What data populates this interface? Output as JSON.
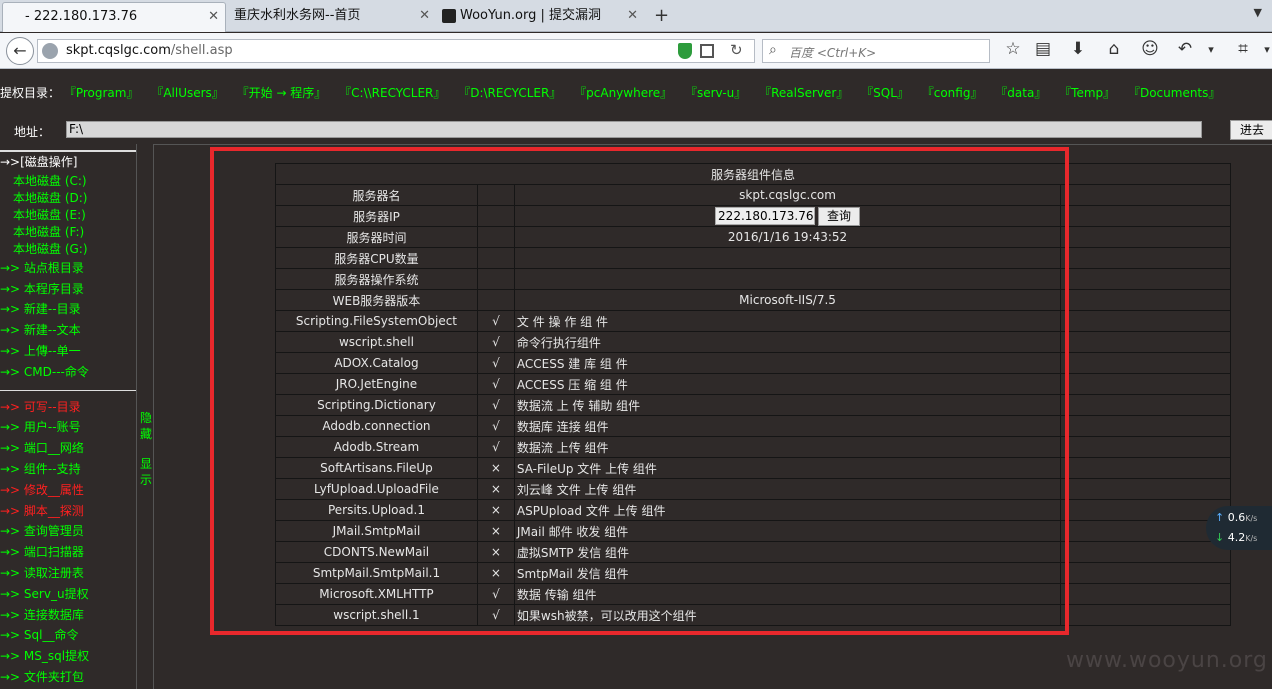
{
  "browser": {
    "tabs": [
      {
        "title": "- 222.180.173.76",
        "active": true
      },
      {
        "title": "重庆水利水务网--首页",
        "active": false
      },
      {
        "title": "WooYun.org | 提交漏洞",
        "active": false
      }
    ],
    "new_tab": "+",
    "url_domain": "skpt.cqslgc.com",
    "url_path": "/shell.asp",
    "url_prefix": "",
    "search_placeholder": "百度 <Ctrl+K>"
  },
  "page": {
    "priv_label": "提权目录：",
    "priv_links": [
      "『Program』",
      "『AllUsers』",
      "『开始 → 程序』",
      "『C:\\\\RECYCLER』",
      "『D:\\RECYCLER』",
      "『pcAnywhere』",
      "『serv-u』",
      "『RealServer』",
      "『SQL』",
      "『config』",
      "『data』",
      "『Temp』",
      "『Documents』"
    ],
    "address_label": "地址：",
    "address_value": "F:\\",
    "go_button": "进去",
    "sidebar": {
      "disk_header": "→>[磁盘操作]",
      "drives": [
        "本地磁盘 (C:)",
        "本地磁盘 (D:)",
        "本地磁盘 (E:)",
        "本地磁盘 (F:)",
        "本地磁盘 (G:)"
      ],
      "group1": [
        {
          "label": "→> 站点根目录",
          "red": false
        },
        {
          "label": "→> 本程序目录",
          "red": false
        },
        {
          "label": "→> 新建--目录",
          "red": false
        },
        {
          "label": "→> 新建--文本",
          "red": false
        },
        {
          "label": "→> 上傳--单一",
          "red": false
        },
        {
          "label": "→> CMD---命令",
          "red": false
        }
      ],
      "group2": [
        {
          "label": "→> 可写--目录",
          "red": true
        },
        {
          "label": "→> 用户--账号",
          "red": false
        },
        {
          "label": "→> 端口__网络",
          "red": false
        },
        {
          "label": "→> 组件--支持",
          "red": false
        },
        {
          "label": "→> 修改__属性",
          "red": true
        },
        {
          "label": "→> 脚本__探测",
          "red": true
        },
        {
          "label": "→> 查询管理员",
          "red": false
        },
        {
          "label": "→> 端口扫描器",
          "red": false
        },
        {
          "label": "→> 读取注册表",
          "red": false
        },
        {
          "label": "→> Serv_u提权",
          "red": false
        },
        {
          "label": "→> 连接数据库",
          "red": false
        },
        {
          "label": "→> Sql__命令",
          "red": false
        },
        {
          "label": "→> MS_sql提权",
          "red": false
        },
        {
          "label": "→> 文件夹打包",
          "red": false
        }
      ]
    },
    "splitter": {
      "hide": "隐藏",
      "show": "显示"
    },
    "table": {
      "title": "服务器组件信息",
      "server_name_label": "服务器名",
      "server_name": "skpt.cqslgc.com",
      "server_ip_label": "服务器IP",
      "server_ip": "222.180.173.76",
      "query_button": "查询",
      "server_time_label": "服务器时间",
      "server_time": "2016/1/16 19:43:52",
      "cpu_label": "服务器CPU数量",
      "cpu_value": "",
      "os_label": "服务器操作系统",
      "os_value": "",
      "web_label": "WEB服务器版本",
      "web_value": "Microsoft-IIS/7.5",
      "components": [
        {
          "name": "Scripting.FileSystemObject",
          "mark": "√",
          "desc": "文 件 操 作 组 件"
        },
        {
          "name": "wscript.shell",
          "mark": "√",
          "desc": "命令行执行组件"
        },
        {
          "name": "ADOX.Catalog",
          "mark": "√",
          "desc": "ACCESS 建 库 组 件"
        },
        {
          "name": "JRO.JetEngine",
          "mark": "√",
          "desc": "ACCESS 压 缩 组 件"
        },
        {
          "name": "Scripting.Dictionary",
          "mark": "√",
          "desc": "数据流 上 传 辅助 组件"
        },
        {
          "name": "Adodb.connection",
          "mark": "√",
          "desc": "数据库 连接 组件"
        },
        {
          "name": "Adodb.Stream",
          "mark": "√",
          "desc": "数据流 上传 组件"
        },
        {
          "name": "SoftArtisans.FileUp",
          "mark": "×",
          "desc": "SA-FileUp 文件 上传 组件"
        },
        {
          "name": "LyfUpload.UploadFile",
          "mark": "×",
          "desc": "刘云峰 文件 上传 组件"
        },
        {
          "name": "Persits.Upload.1",
          "mark": "×",
          "desc": "ASPUpload 文件 上传 组件"
        },
        {
          "name": "JMail.SmtpMail",
          "mark": "×",
          "desc": "JMail 邮件 收发 组件"
        },
        {
          "name": "CDONTS.NewMail",
          "mark": "×",
          "desc": "虚拟SMTP 发信 组件"
        },
        {
          "name": "SmtpMail.SmtpMail.1",
          "mark": "×",
          "desc": "SmtpMail 发信 组件"
        },
        {
          "name": "Microsoft.XMLHTTP",
          "mark": "√",
          "desc": "数据 传输 组件"
        },
        {
          "name": "wscript.shell.1",
          "mark": "√",
          "desc": "如果wsh被禁，可以改用这个组件"
        }
      ]
    },
    "net_widget": {
      "up": "0.6",
      "down": "4.2",
      "unit": "K/s"
    },
    "watermark": "www.wooyun.org",
    "highlight_color": "#e8282c"
  }
}
